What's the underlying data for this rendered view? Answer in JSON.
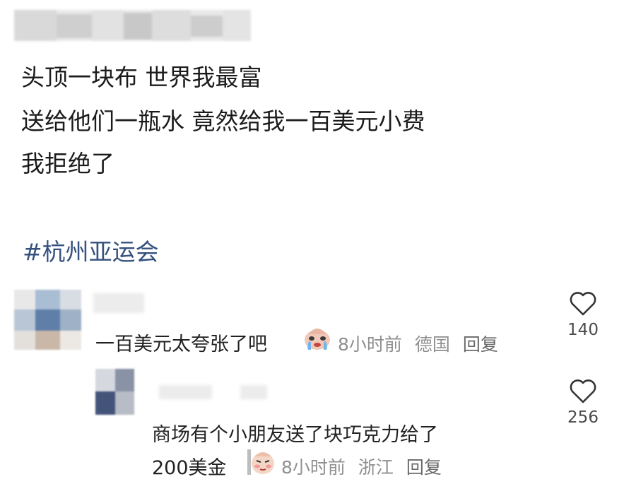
{
  "post": {
    "lines": [
      "头顶一块布 世界我最富",
      "送给他们一瓶水 竟然给我一百美元小费",
      "我拒绝了"
    ],
    "hashtag": "#杭州亚运会"
  },
  "comments": [
    {
      "text": "一百美元太夸张了吧",
      "emoji": "crying-face-sticker",
      "time": "8小时前",
      "location": "德国",
      "reply": "回复",
      "likes": "140"
    },
    {
      "text_line1": "商场有个小朋友送了块巧克力给了",
      "text_line2": "200美金",
      "emoji": "blushing-face-sticker",
      "time": "8小时前",
      "location": "浙江",
      "reply": "回复",
      "likes": "256"
    }
  ],
  "colors": {
    "hashtag": "#35517e",
    "meta": "#8f8f8f",
    "text": "#1b1b1b"
  }
}
